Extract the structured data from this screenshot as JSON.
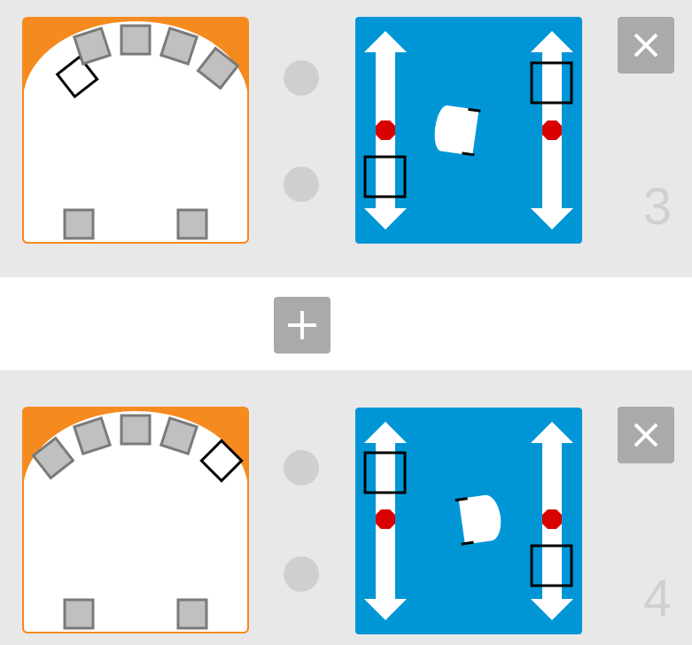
{
  "events": [
    {
      "number": "3",
      "colors": {
        "accent": "#f58a1f",
        "panel": "#0096d6",
        "stop": "#d90000"
      },
      "robot_icon": "robot-top-view-icon",
      "close_icon": "close-icon"
    },
    {
      "number": "4",
      "colors": {
        "accent": "#f58a1f",
        "panel": "#0096d6",
        "stop": "#d90000"
      },
      "robot_icon": "robot-top-view-icon",
      "close_icon": "close-icon"
    }
  ],
  "add_icon": "plus-icon"
}
